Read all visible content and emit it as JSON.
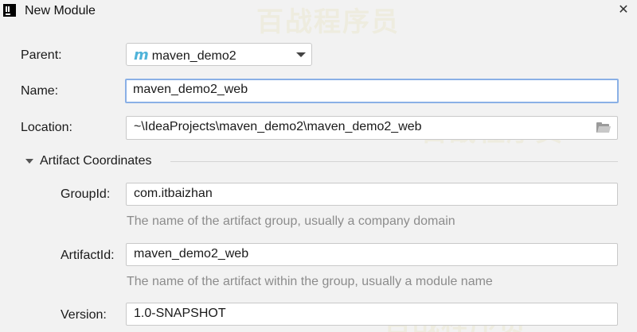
{
  "window": {
    "title": "New Module",
    "close_glyph": "✕"
  },
  "form": {
    "parent": {
      "label": "Parent:",
      "value": "maven_demo2",
      "icon": "m"
    },
    "name": {
      "label": "Name:",
      "value": "maven_demo2_web"
    },
    "location": {
      "label": "Location:",
      "value": "~\\IdeaProjects\\maven_demo2\\maven_demo2_web"
    }
  },
  "artifact": {
    "section_title": "Artifact Coordinates",
    "group_id": {
      "label": "GroupId:",
      "value": "com.itbaizhan",
      "hint": "The name of the artifact group, usually a company domain"
    },
    "artifact_id": {
      "label": "ArtifactId:",
      "value": "maven_demo2_web",
      "hint": "The name of the artifact within the group, usually a module name"
    },
    "version": {
      "label": "Version:",
      "value": "1.0-SNAPSHOT"
    }
  },
  "watermark": {
    "text": "百战程序员"
  },
  "colors": {
    "background": "#f2f2f2",
    "focus_border": "#8ab0e6",
    "maven_icon": "#4fb3d9",
    "hint_text": "#8c8c8c"
  }
}
